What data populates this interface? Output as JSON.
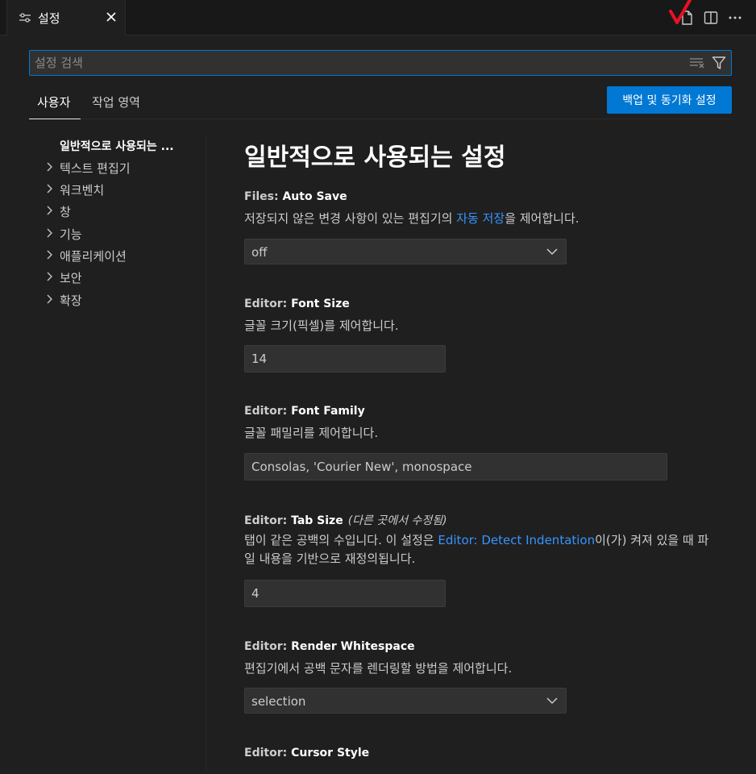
{
  "tab": {
    "title": "설정",
    "icon": "settings-sliders-icon",
    "close_icon": "close-icon"
  },
  "actions": {
    "open_json_icon": "open-settings-json-icon",
    "split_icon": "split-editor-icon",
    "more_icon": "more-actions-icon"
  },
  "search": {
    "placeholder": "설정 검색",
    "value": ""
  },
  "scopes": {
    "user": "사용자",
    "workspace": "작업 영역",
    "active": "user"
  },
  "sync_button": "백업 및 동기화 설정",
  "toc": [
    {
      "label": "일반적으로 사용되는 ...",
      "selected": true,
      "expandable": false
    },
    {
      "label": "텍스트 편집기",
      "selected": false,
      "expandable": true
    },
    {
      "label": "워크벤치",
      "selected": false,
      "expandable": true
    },
    {
      "label": "창",
      "selected": false,
      "expandable": true
    },
    {
      "label": "기능",
      "selected": false,
      "expandable": true
    },
    {
      "label": "애플리케이션",
      "selected": false,
      "expandable": true
    },
    {
      "label": "보안",
      "selected": false,
      "expandable": true
    },
    {
      "label": "확장",
      "selected": false,
      "expandable": true
    }
  ],
  "main": {
    "title": "일반적으로 사용되는 설정",
    "settings": [
      {
        "category": "Files: ",
        "name": "Auto Save",
        "desc_pre": "저장되지 않은 변경 사항이 있는 편집기의 ",
        "desc_link": "자동 저장",
        "desc_post": "을 제어합니다.",
        "control": "dropdown",
        "value": "off"
      },
      {
        "category": "Editor: ",
        "name": "Font Size",
        "desc": "글꼴 크기(픽셀)를 제어합니다.",
        "control": "text",
        "value": "14"
      },
      {
        "category": "Editor: ",
        "name": "Font Family",
        "desc": "글꼴 패밀리를 제어합니다.",
        "control": "text",
        "value": "Consolas, 'Courier New', monospace"
      },
      {
        "category": "Editor: ",
        "name": "Tab Size",
        "modified": "(다른 곳에서 수정됨)",
        "desc_pre": "탭이 같은 공백의 수입니다. 이 설정은 ",
        "desc_link": "Editor: Detect Indentation",
        "desc_post": "이(가) 켜져 있을 때 파일 내용을 기반으로 재정의됩니다.",
        "control": "text",
        "value": "4"
      },
      {
        "category": "Editor: ",
        "name": "Render Whitespace",
        "desc": "편집기에서 공백 문자를 렌더링할 방법을 제어합니다.",
        "control": "dropdown",
        "value": "selection"
      },
      {
        "category": "Editor: ",
        "name": "Cursor Style"
      }
    ]
  },
  "colors": {
    "accent": "#0078d4",
    "link": "#3794ff",
    "background": "#1f1f1f",
    "annotation": "#e81123"
  }
}
